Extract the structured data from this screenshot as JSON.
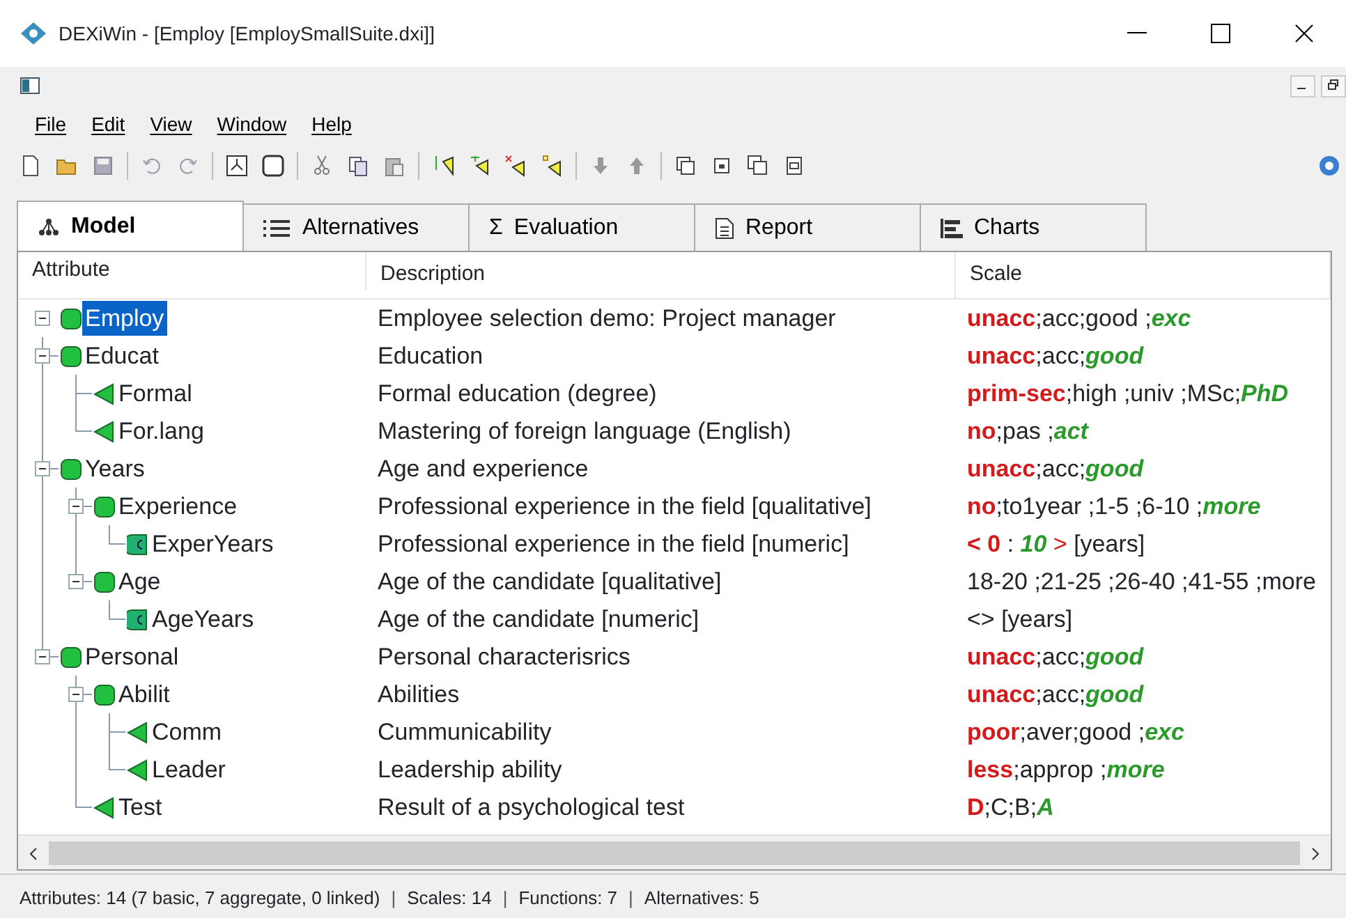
{
  "window": {
    "title": "DEXiWin - [Employ [EmploySmallSuite.dxi]]"
  },
  "menu": [
    "File",
    "Edit",
    "View",
    "Window",
    "Help"
  ],
  "tabs": [
    {
      "label": "Model",
      "selected": true
    },
    {
      "label": "Alternatives",
      "selected": false
    },
    {
      "label": "Evaluation",
      "selected": false,
      "glyph": "Σ"
    },
    {
      "label": "Report",
      "selected": false
    },
    {
      "label": "Charts",
      "selected": false
    }
  ],
  "tree": {
    "columns": [
      "Attribute",
      "Description",
      "Scale"
    ],
    "rows": [
      {
        "name": "Employ",
        "kind": "aggregate",
        "selected": true,
        "expanded": true,
        "description": "Employee selection demo: Project manager",
        "scale": [
          {
            "text": "unacc",
            "kind": "bad"
          },
          {
            "text": ";acc;good ;",
            "kind": "plain"
          },
          {
            "text": "exc",
            "kind": "good"
          }
        ],
        "children": [
          {
            "name": "Educat",
            "kind": "aggregate",
            "selected": false,
            "expanded": true,
            "description": "Education",
            "scale": [
              {
                "text": "unacc",
                "kind": "bad"
              },
              {
                "text": ";acc;",
                "kind": "plain"
              },
              {
                "text": "good",
                "kind": "good"
              }
            ],
            "children": [
              {
                "name": "Formal",
                "kind": "basic",
                "selected": false,
                "description": "Formal education (degree)",
                "scale": [
                  {
                    "text": "prim-sec",
                    "kind": "bad"
                  },
                  {
                    "text": ";high ;univ ;MSc;",
                    "kind": "plain"
                  },
                  {
                    "text": "PhD",
                    "kind": "good"
                  }
                ]
              },
              {
                "name": "For.lang",
                "kind": "basic",
                "selected": false,
                "description": "Mastering of foreign language (English)",
                "scale": [
                  {
                    "text": "no",
                    "kind": "bad"
                  },
                  {
                    "text": ";pas ;",
                    "kind": "plain"
                  },
                  {
                    "text": "act",
                    "kind": "good"
                  }
                ]
              }
            ]
          },
          {
            "name": "Years",
            "kind": "aggregate",
            "selected": false,
            "expanded": true,
            "description": "Age and experience",
            "scale": [
              {
                "text": "unacc",
                "kind": "bad"
              },
              {
                "text": ";acc;",
                "kind": "plain"
              },
              {
                "text": "good",
                "kind": "good"
              }
            ],
            "children": [
              {
                "name": "Experience",
                "kind": "aggregate",
                "selected": false,
                "expanded": true,
                "description": "Professional experience in the field [qualitative]",
                "scale": [
                  {
                    "text": "no",
                    "kind": "bad"
                  },
                  {
                    "text": ";to1year ;1-5 ;6-10 ;",
                    "kind": "plain"
                  },
                  {
                    "text": "more",
                    "kind": "good"
                  }
                ],
                "children": [
                  {
                    "name": "ExperYears",
                    "kind": "continuous",
                    "selected": false,
                    "description": "Professional experience in the field [numeric]",
                    "scale": [
                      {
                        "text": "< 0",
                        "kind": "bad"
                      },
                      {
                        "text": " : ",
                        "kind": "plain"
                      },
                      {
                        "text": "10",
                        "kind": "good"
                      },
                      {
                        "text": " >",
                        "kind": "badplain"
                      },
                      {
                        "text": " [years]",
                        "kind": "plain"
                      }
                    ]
                  }
                ]
              },
              {
                "name": "Age",
                "kind": "aggregate",
                "selected": false,
                "expanded": true,
                "description": "Age of the candidate [qualitative]",
                "scale": [
                  {
                    "text": "18-20 ;21-25 ;26-40 ;41-55 ;more",
                    "kind": "plain"
                  }
                ],
                "children": [
                  {
                    "name": "AgeYears",
                    "kind": "continuous",
                    "selected": false,
                    "description": "Age of the candidate [numeric]",
                    "scale": [
                      {
                        "text": "<> [years]",
                        "kind": "plain"
                      }
                    ]
                  }
                ]
              }
            ]
          },
          {
            "name": "Personal",
            "kind": "aggregate",
            "selected": false,
            "expanded": true,
            "description": "Personal characterisrics",
            "scale": [
              {
                "text": "unacc",
                "kind": "bad"
              },
              {
                "text": ";acc;",
                "kind": "plain"
              },
              {
                "text": "good",
                "kind": "good"
              }
            ],
            "children": [
              {
                "name": "Abilit",
                "kind": "aggregate",
                "selected": false,
                "expanded": true,
                "description": "Abilities",
                "scale": [
                  {
                    "text": "unacc",
                    "kind": "bad"
                  },
                  {
                    "text": ";acc;",
                    "kind": "plain"
                  },
                  {
                    "text": "good",
                    "kind": "good"
                  }
                ],
                "children": [
                  {
                    "name": "Comm",
                    "kind": "basic",
                    "selected": false,
                    "description": "Cummunicability",
                    "scale": [
                      {
                        "text": "poor",
                        "kind": "bad"
                      },
                      {
                        "text": ";aver;good ;",
                        "kind": "plain"
                      },
                      {
                        "text": "exc",
                        "kind": "good"
                      }
                    ]
                  },
                  {
                    "name": "Leader",
                    "kind": "basic",
                    "selected": false,
                    "description": "Leadership ability",
                    "scale": [
                      {
                        "text": "less",
                        "kind": "bad"
                      },
                      {
                        "text": ";approp ;",
                        "kind": "plain"
                      },
                      {
                        "text": "more",
                        "kind": "good"
                      }
                    ]
                  }
                ]
              },
              {
                "name": "Test",
                "kind": "basic",
                "selected": false,
                "description": "Result of a psychological test",
                "scale": [
                  {
                    "text": "D",
                    "kind": "bad"
                  },
                  {
                    "text": ";C;B;",
                    "kind": "plain"
                  },
                  {
                    "text": "A",
                    "kind": "good"
                  }
                ]
              }
            ]
          }
        ]
      }
    ]
  },
  "status_bar": [
    {
      "kind": "text",
      "text": "Attributes: 14 (7 basic, 7 aggregate, 0 linked)"
    },
    {
      "kind": "separator",
      "text": "|"
    },
    {
      "kind": "text",
      "text": "Scales: 14"
    },
    {
      "kind": "separator",
      "text": "|"
    },
    {
      "kind": "text",
      "text": "Functions: 7"
    },
    {
      "kind": "separator",
      "text": "|"
    },
    {
      "kind": "text",
      "text": "Alternatives: 5"
    }
  ]
}
